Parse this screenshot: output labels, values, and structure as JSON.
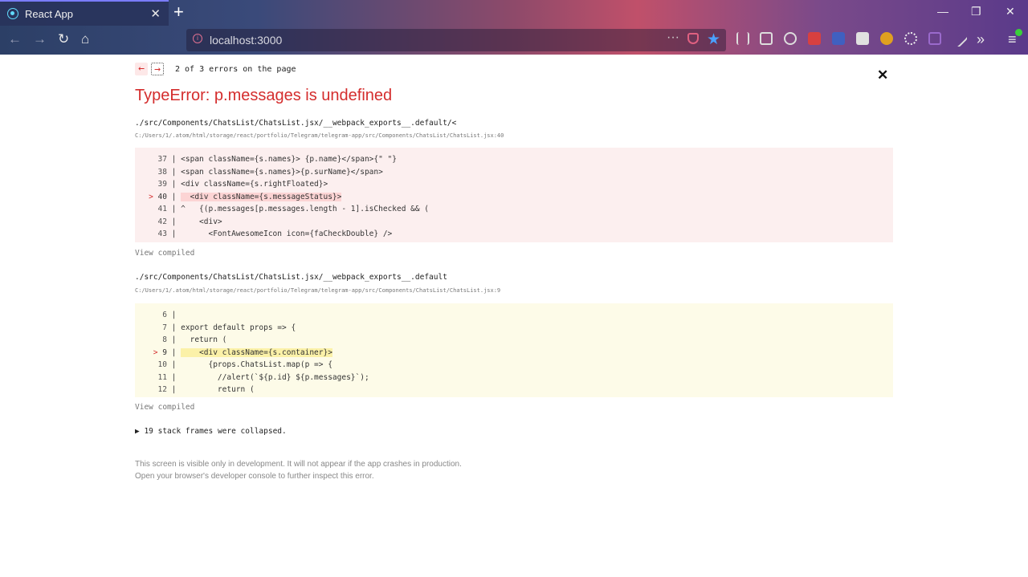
{
  "browser": {
    "tab_title": "React App",
    "tab_close": "✕",
    "new_tab": "+",
    "url": "localhost:3000",
    "page_actions": "···",
    "window_controls": {
      "minimize": "—",
      "restore": "❐",
      "close": "✕"
    }
  },
  "overlay": {
    "prev_arrow": "←",
    "next_arrow": "→",
    "error_counter": "2 of 3 errors on the page",
    "close": "✕",
    "error_title": "TypeError: p.messages is undefined",
    "frames": [
      {
        "title": "./src/Components/ChatsList/ChatsList.jsx/__webpack_exports__.default/<",
        "path": "C:/Users/1/.atom/html/storage/react/portfolio/Telegram/telegram-app/src/Components/ChatsList/ChatsList.jsx:40",
        "lines": [
          {
            "marker": "",
            "num": "37",
            "sep": " | ",
            "code": "<span className={s.names}> {p.name}</span>{\" \"}"
          },
          {
            "marker": "",
            "num": "38",
            "sep": " | ",
            "code": "<span className={s.names}>{p.surName}</span>"
          },
          {
            "marker": "",
            "num": "39",
            "sep": " | ",
            "code": "<div className={s.rightFloated}>"
          },
          {
            "marker": ">",
            "num": "40",
            "sep": " | ",
            "code": "  <div className={s.messageStatus}>"
          },
          {
            "marker": "",
            "num": "41",
            "sep": " | ^ ",
            "code": "  {(p.messages[p.messages.length - 1].isChecked && ("
          },
          {
            "marker": "",
            "num": "42",
            "sep": " | ",
            "code": "    <div>"
          },
          {
            "marker": "",
            "num": "43",
            "sep": " | ",
            "code": "      <FontAwesomeIcon icon={faCheckDouble} />"
          }
        ],
        "view_compiled": "View compiled"
      },
      {
        "title": "./src/Components/ChatsList/ChatsList.jsx/__webpack_exports__.default",
        "path": "C:/Users/1/.atom/html/storage/react/portfolio/Telegram/telegram-app/src/Components/ChatsList/ChatsList.jsx:9",
        "lines": [
          {
            "marker": "",
            "num": "6",
            "sep": " | ",
            "code": ""
          },
          {
            "marker": "",
            "num": "7",
            "sep": " | ",
            "code": "export default props => {"
          },
          {
            "marker": "",
            "num": "8",
            "sep": " | ",
            "code": "  return ("
          },
          {
            "marker": ">",
            "num": "9",
            "sep": " | ",
            "code": "    <div className={s.container}>"
          },
          {
            "marker": "",
            "num": "10",
            "sep": " | ",
            "code": "      {props.ChatsList.map(p => {"
          },
          {
            "marker": "",
            "num": "11",
            "sep": " | ",
            "code": "        //alert(`${p.id} ${p.messages}`);"
          },
          {
            "marker": "",
            "num": "12",
            "sep": " | ",
            "code": "        return ("
          }
        ],
        "view_compiled": "View compiled"
      }
    ],
    "collapsed": "▶ 19 stack frames were collapsed.",
    "footer_line1": "This screen is visible only in development. It will not appear if the app crashes in production.",
    "footer_line2": "Open your browser's developer console to further inspect this error."
  }
}
